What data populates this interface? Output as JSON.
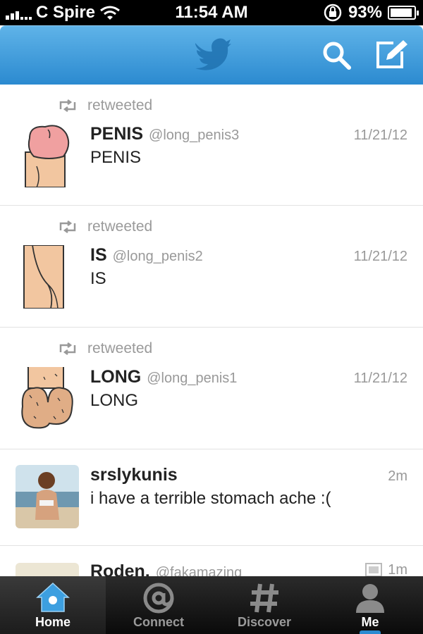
{
  "status_bar": {
    "carrier": "C Spire",
    "time": "11:54 AM",
    "battery_percent": "93%",
    "battery_level": 0.93
  },
  "nav": {
    "icons": [
      "twitter-bird-icon",
      "search-icon",
      "compose-icon"
    ]
  },
  "timeline": {
    "tweets": [
      {
        "retweet_label": "retweeted",
        "name": "PENIS",
        "handle": "@long_penis3",
        "time": "11/21/12",
        "text": "PENIS"
      },
      {
        "retweet_label": "retweeted",
        "name": "IS",
        "handle": "@long_penis2",
        "time": "11/21/12",
        "text": "IS"
      },
      {
        "retweet_label": "retweeted",
        "name": "LONG",
        "handle": "@long_penis1",
        "time": "11/21/12",
        "text": "LONG"
      },
      {
        "name": "srslykunis",
        "time": "2m",
        "text": "i have a terrible stomach ache :("
      },
      {
        "name": "Roden.",
        "handle": "@fakamazing",
        "time": "1m"
      }
    ]
  },
  "tab_bar": {
    "tabs": [
      {
        "label": "Home",
        "icon": "home-icon"
      },
      {
        "label": "Connect",
        "icon": "at-icon"
      },
      {
        "label": "Discover",
        "icon": "hash-icon"
      },
      {
        "label": "Me",
        "icon": "person-icon"
      }
    ],
    "active": "Home"
  },
  "colors": {
    "nav_blue": "#2b8ad0",
    "skin": "#f2c6a0",
    "tip_pink": "#f0a0a0"
  }
}
